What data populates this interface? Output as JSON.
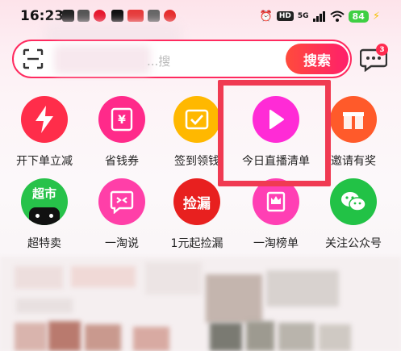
{
  "status_bar": {
    "time": "16:23",
    "hd": "HD",
    "signal_label": "5G",
    "battery": "84"
  },
  "search": {
    "placeholder": "...搜",
    "button_label": "搜索"
  },
  "messages": {
    "badge_count": "3"
  },
  "grid": {
    "items": [
      {
        "label": "开下单立减",
        "icon": "lightning-icon",
        "color": "#ff2d4a"
      },
      {
        "label": "省钱券",
        "icon": "coupon-icon",
        "color": "#ff2a8a"
      },
      {
        "label": "签到领钱",
        "icon": "checkin-icon",
        "color": "#ffb800"
      },
      {
        "label": "今日直播清单",
        "icon": "play-icon",
        "color": "#ff2bd6"
      },
      {
        "label": "邀请有奖",
        "icon": "gift-icon",
        "color": "#ff5a2a"
      },
      {
        "label": "超特卖",
        "icon": "tmall-supermarket-icon",
        "color": "#27c24a",
        "icon_text": "超市"
      },
      {
        "label": "一淘说",
        "icon": "chat-bubble-icon",
        "color": "#ff3fa8"
      },
      {
        "label": "1元起捡漏",
        "icon": "bargain-icon",
        "color": "#e8201f",
        "icon_text": "捡漏"
      },
      {
        "label": "一淘榜单",
        "icon": "crown-icon",
        "color": "#ff3fb4"
      },
      {
        "label": "关注公众号",
        "icon": "wechat-icon",
        "color": "#22c246"
      }
    ]
  },
  "colors": {
    "accent": "#ff2a5f",
    "highlight": "#f03a52"
  }
}
